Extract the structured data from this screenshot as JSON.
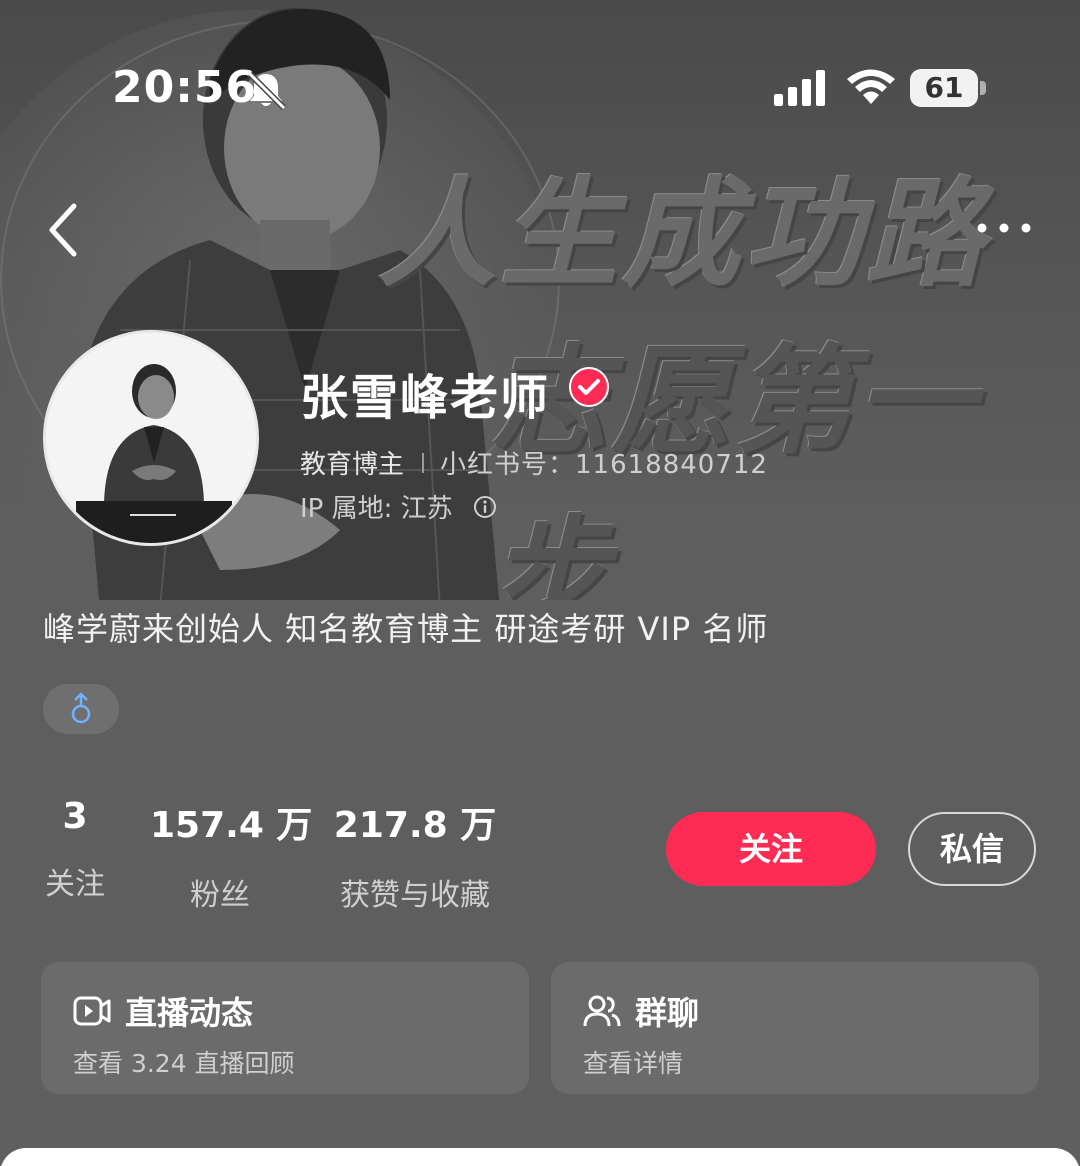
{
  "status_bar": {
    "time": "20:56",
    "battery": "61",
    "icons": [
      "bell-muted-icon",
      "signal-icon",
      "wifi-icon",
      "battery-icon"
    ]
  },
  "nav": {
    "back_icon": "chevron-left-icon",
    "more_icon": "more-dots-icon"
  },
  "cover": {
    "slogan_line1": "人生成功路",
    "slogan_line2": "志愿第一步"
  },
  "profile": {
    "nickname": "张雪峰老师",
    "verified_icon": "verified-check-icon",
    "verified_color": "#fe2c55",
    "category": "教育博主",
    "red_id": "小红书号：11618840712",
    "ip_location": "IP 属地: 江苏",
    "info_icon": "info-circle-icon",
    "bio": "峰学蔚来创始人 知名教育博主 研途考研 VIP 名师",
    "gender_icon": "male-icon",
    "gender_color": "#6fb3ff"
  },
  "stats": {
    "following_value": "3",
    "following_label": "关注",
    "fans_value": "157.4 万",
    "fans_label": "粉丝",
    "likes_value": "217.8 万",
    "likes_label": "获赞与收藏"
  },
  "actions": {
    "follow_label": "关注",
    "follow_color": "#fe2c55",
    "message_label": "私信"
  },
  "cards": {
    "live": {
      "icon": "live-video-icon",
      "title": "直播动态",
      "subtitle": "查看 3.24 直播回顾"
    },
    "group": {
      "icon": "group-users-icon",
      "title": "群聊",
      "subtitle": "查看详情"
    }
  }
}
